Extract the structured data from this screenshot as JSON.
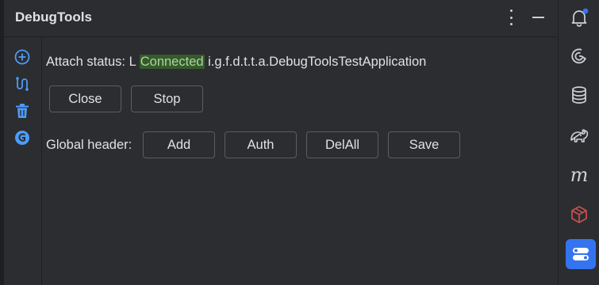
{
  "window": {
    "title": "DebugTools"
  },
  "header": {
    "more_icon": "more-vertical-icon",
    "minimize_icon": "minimize-icon"
  },
  "toolstrip": {
    "icons": [
      "add-circle-icon",
      "connect-nodes-icon",
      "trash-icon",
      "groovy-icon"
    ]
  },
  "status": {
    "label": "Attach status:",
    "prefix": "L",
    "state": "Connected",
    "app": "i.g.f.d.t.t.a.DebugToolsTestApplication",
    "state_color": "#375a2b"
  },
  "actions": {
    "close_label": "Close",
    "stop_label": "Stop"
  },
  "global_header": {
    "label": "Global header:",
    "add_label": "Add",
    "auth_label": "Auth",
    "delall_label": "DelAll",
    "save_label": "Save"
  },
  "right_bar": {
    "icons": [
      "notifications-icon",
      "ai-assistant-icon",
      "database-icon",
      "gradle-icon",
      "maven-icon",
      "rest-client-icon",
      "debugtools-icon"
    ],
    "active": "debugtools-icon",
    "accent": "#3574f0"
  }
}
